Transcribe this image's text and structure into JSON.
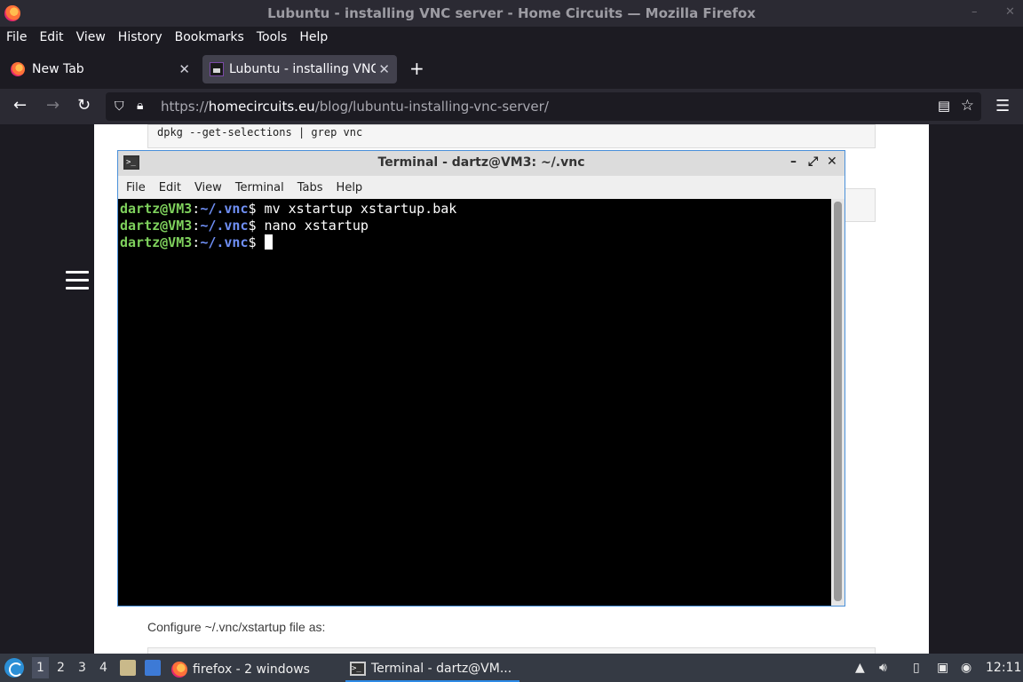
{
  "window": {
    "title": "Lubuntu - installing VNC server - Home Circuits — Mozilla Firefox",
    "controls": [
      "–",
      "✕"
    ]
  },
  "menubar": {
    "items": [
      "File",
      "Edit",
      "View",
      "History",
      "Bookmarks",
      "Tools",
      "Help"
    ]
  },
  "tabs": [
    {
      "label": "New Tab",
      "close": "✕",
      "favicon": "firefox-icon"
    },
    {
      "label": "Lubuntu - installing VNC",
      "close": "✕",
      "favicon": "homecircuits-icon",
      "active": true
    }
  ],
  "newtab": "+",
  "nav": {
    "back": "←",
    "forward": "→",
    "reload": "↻",
    "url_prefix": "https://",
    "url_host": "homecircuits.eu",
    "url_path": "/blog/lubuntu-installing-vnc-server/",
    "menu": "☰"
  },
  "page": {
    "code1": "dpkg --get-selections | grep vnc",
    "configure_text": "Configure  ~/.vnc/xstartup file as:"
  },
  "terminal": {
    "title": "Terminal - dartz@VM3: ~/.vnc",
    "controls": [
      "–",
      "⤢",
      "✕"
    ],
    "menu": [
      "File",
      "Edit",
      "View",
      "Terminal",
      "Tabs",
      "Help"
    ],
    "lines": [
      {
        "user": "dartz@VM3",
        "path": "~/.vnc",
        "cmd": " mv xstartup xstartup.bak"
      },
      {
        "user": "dartz@VM3",
        "path": "~/.vnc",
        "cmd": " nano xstartup"
      },
      {
        "user": "dartz@VM3",
        "path": "~/.vnc",
        "cmd": " "
      }
    ]
  },
  "taskbar": {
    "workspaces": [
      "1",
      "2",
      "3",
      "4"
    ],
    "tasks": [
      {
        "label": "firefox - 2 windows",
        "icon": "firefox-icon"
      },
      {
        "label": "Terminal - dartz@VM...",
        "icon": "terminal-icon"
      }
    ],
    "clock": "12:11"
  },
  "colors": {
    "accent": "#2e8be6",
    "prompt_user": "#7ed05c",
    "prompt_path": "#6f8ff5"
  }
}
